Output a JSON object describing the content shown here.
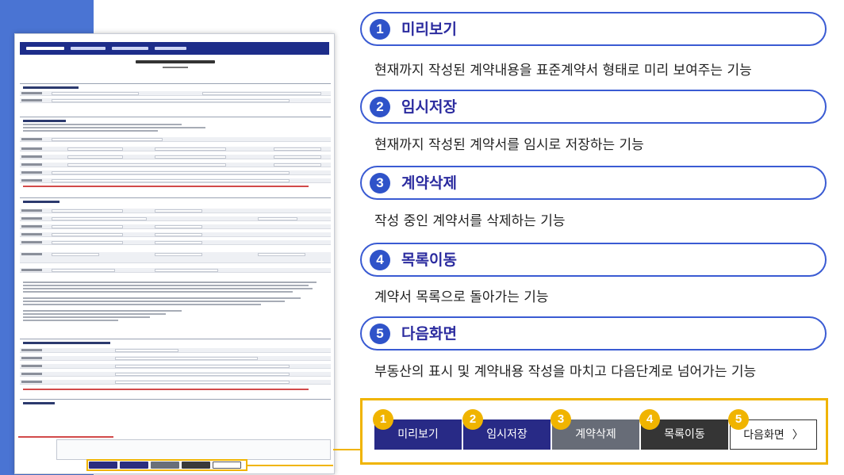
{
  "features": [
    {
      "num": "1",
      "title": "미리보기",
      "desc": "현재까지 작성된 계약내용을 표준계약서 형태로 미리 보여주는 기능"
    },
    {
      "num": "2",
      "title": "임시저장",
      "desc": "현재까지 작성된 계약서를 임시로 저장하는 기능"
    },
    {
      "num": "3",
      "title": "계약삭제",
      "desc": "작성 중인 계약서를 삭제하는 기능"
    },
    {
      "num": "4",
      "title": "목록이동",
      "desc": "계약서 목록으로 돌아가는 기능"
    },
    {
      "num": "5",
      "title": "다음화면",
      "desc": "부동산의 표시 및 계약내용 작성을 마치고 다음단계로 넘어가는 기능"
    }
  ],
  "buttons": [
    {
      "num": "1",
      "label": "미리보기"
    },
    {
      "num": "2",
      "label": "임시저장"
    },
    {
      "num": "3",
      "label": "계약삭제"
    },
    {
      "num": "4",
      "label": "목록이동"
    },
    {
      "num": "5",
      "label": "다음화면",
      "icon": "chevron-right-icon",
      "glyph": "〉"
    }
  ],
  "colors": {
    "accent_blue": "#3a5bd3",
    "number_circle": "#2f53c9",
    "title_text": "#2b2b9f",
    "callout_border": "#f0b400",
    "button_navy": "#282a86",
    "button_gray": "#676c77",
    "button_dark": "#353535",
    "left_band": "#4a74d3"
  }
}
